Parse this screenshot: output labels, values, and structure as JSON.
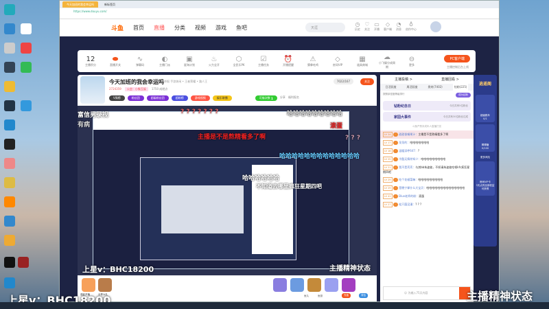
{
  "browser": {
    "tab_active": "今天加班的我会幸运吗",
    "tab_second": "新标签页",
    "url": "https://www.douyu.com/"
  },
  "header": {
    "logo": "斗鱼",
    "nav": [
      "首页",
      "直播",
      "分类",
      "视频",
      "游戏",
      "鱼吧"
    ],
    "search_placeholder": "天涯",
    "icons": [
      "历史",
      "关注",
      "开播",
      "客户端",
      "消息",
      "创作中心"
    ]
  },
  "toolbar": {
    "score_value": "12",
    "score_label": "主播积分",
    "items": [
      "直播开关",
      "弹幕码",
      "主播门派",
      "星海计划",
      "火力全开",
      "全民乐PK",
      "主播任务",
      "开播提醒",
      "猜拳吃鸡",
      "房间VIP",
      "道具商城",
      "小飞碟分成周期",
      "更多"
    ],
    "pc_button": "PC客户端",
    "pc_sub": "主播控制后台上线"
  },
  "stream": {
    "title": "今天加班的我会幸运吗",
    "category": "举报  手游休闲 • 王者荣耀 • 路人王",
    "hot": "2724359",
    "follow_count": "7022/167",
    "follow": "关注",
    "fish_points": "1750 成就点",
    "guild": "公会：小象互娱",
    "pills": [
      "V周榜",
      "粉丝团",
      "超级粉丝团",
      "超粉榜",
      "游戏视频",
      "娱乐联播"
    ],
    "chance": "可偷次数",
    "chance_count": "1",
    "share": "分享",
    "report": "福利报名",
    "avatar_tags": [
      "鱼吧",
      "公告"
    ]
  },
  "danmaku": [
    "富信男录视",
    "有病",
    "? ? ? ? ? ? ?",
    "哈哈哈哈哈哈哈哈哈",
    "主播是不是熬精看多了啊",
    "滚蛋",
    "? ? ?",
    "哈哈哈哈哈哈哈哈哈哈哈哈哈",
    "哈哈哈哈哈哈",
    "不知道去哪里疯狂星期四吧"
  ],
  "overlay": {
    "left": "上星v：BHC18200",
    "right": "主播精神状态"
  },
  "chat": {
    "top_links": [
      "主播投稿 >",
      "直播回看 >"
    ],
    "tabs": [
      "日活跃度",
      "周活跃度",
      "贵宾(7402)",
      "钻粉(225)"
    ],
    "rank_hint": "按照亲密度等级排行",
    "join_fans": "成为钻粉",
    "banner1": "钻粉纪念日",
    "banner1_sub": "今日共有5位粉丝",
    "banner2": "家园大事件",
    "banner2_sub": "今日共有30位粉丝达成",
    "notice": "斗鱼严禁未成年人直播打赏",
    "messages": [
      {
        "lv": "LV 24",
        "name": "甜甜香嘴果汁：",
        "text": "主播是不是熬精看多了啊",
        "highlight": true
      },
      {
        "lv": "LV 17",
        "name": "呆呆的：",
        "text": "哈哈哈哈哈哈哈"
      },
      {
        "lv": "LV 16",
        "name": "温暖深呼647：",
        "text": "?"
      },
      {
        "lv": "LV 25",
        "name": "冷酷无情你知少：",
        "text": "哈哈哈哈哈哈哈哈哈"
      },
      {
        "lv": "LV 21",
        "name": "我不是壳壳：",
        "text": "与其bb朱姿彼，不如请朱姿彼吃顿kfc疯狂星期四吧"
      },
      {
        "lv": "LV 29",
        "name": "吃个花椒菜嘛：",
        "text": "哈哈哈哈哈哈哈哈哈"
      },
      {
        "lv": "LV 29",
        "name": "是晚宁掌什么大宝贝：",
        "text": "哈哈哈哈哈哈哈哈哈哈哈哈哈哈"
      },
      {
        "lv": "LV 41",
        "name": "Blue老师的粉：",
        "text": "滚蛋"
      },
      {
        "lv": "LV 27",
        "name": "松只菌没漫：",
        "text": "? ? ?"
      }
    ],
    "input_placeholder": "☺ 为输入75天内容",
    "send": "发送"
  },
  "side": {
    "title": "逍遥阁",
    "items": [
      "超级跑车",
      "0/1",
      "棒棒糖",
      "0/100",
      "更多风险",
      "房间VIP卡",
      "3天点亮全部权益可获得"
    ]
  },
  "giftbar": {
    "items": [
      "观影开播",
      "分享大礼"
    ],
    "stats": [
      "鱼丸",
      "鱼翅",
      "充值",
      "背包"
    ]
  }
}
